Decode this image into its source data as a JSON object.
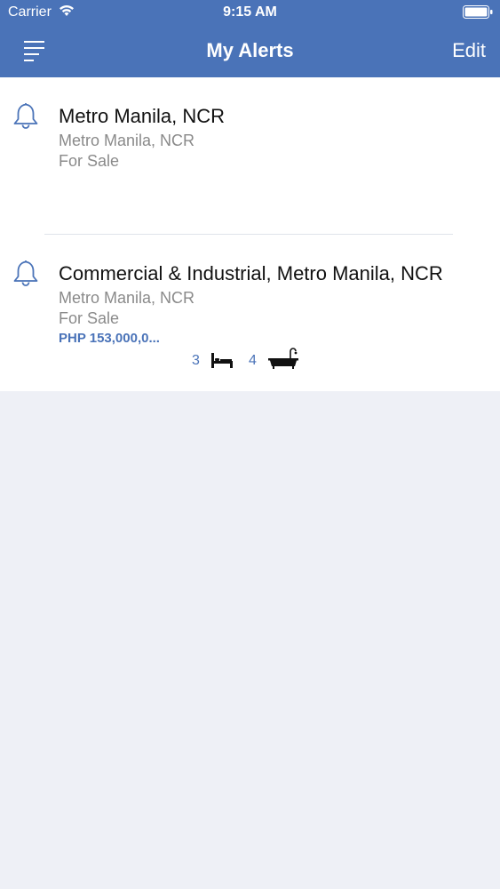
{
  "status_bar": {
    "carrier": "Carrier",
    "time": "9:15 AM"
  },
  "nav": {
    "title": "My Alerts",
    "edit_label": "Edit"
  },
  "alerts": [
    {
      "title": "Metro Manila, NCR",
      "location": "Metro Manila, NCR",
      "listing_type": "For Sale"
    },
    {
      "title": "Commercial & Industrial, Metro Manila, NCR",
      "location": "Metro Manila, NCR",
      "listing_type": "For Sale",
      "price": "PHP 153,000,0...",
      "bedrooms": "3",
      "bathrooms": "4"
    }
  ],
  "colors": {
    "accent": "#4a73b8",
    "background": "#eef0f6"
  }
}
